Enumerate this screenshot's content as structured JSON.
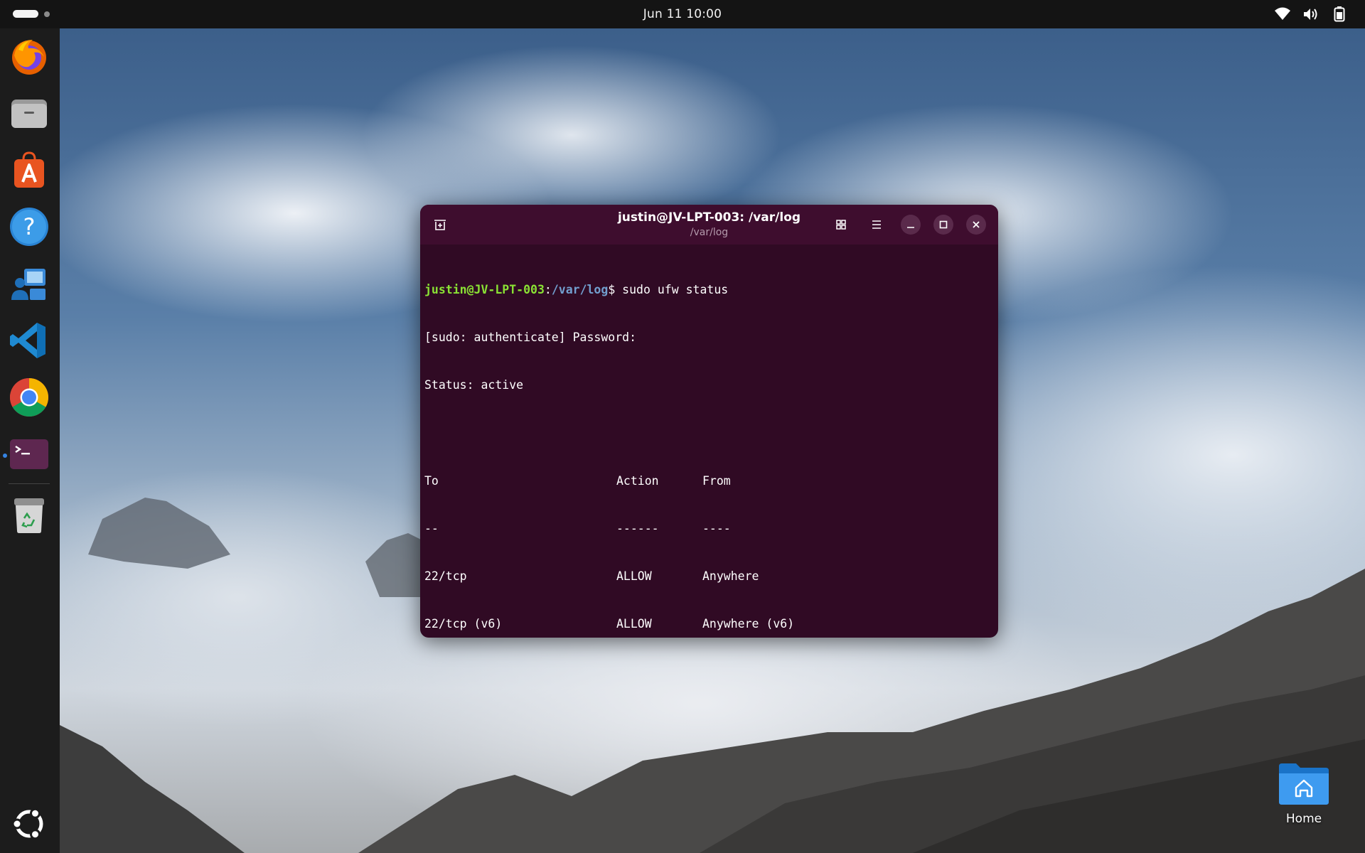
{
  "topbar": {
    "clock": "Jun 11  10:00",
    "tray_icons": [
      "wifi-icon",
      "volume-icon",
      "battery-icon"
    ]
  },
  "dock": {
    "items": [
      {
        "name": "firefox-icon"
      },
      {
        "name": "files-icon"
      },
      {
        "name": "app-center-icon"
      },
      {
        "name": "help-icon"
      },
      {
        "name": "remote-desktop-icon"
      },
      {
        "name": "vscode-icon"
      },
      {
        "name": "chrome-icon"
      },
      {
        "name": "terminal-icon"
      },
      {
        "name": "trash-icon"
      }
    ],
    "show_apps_icon": "ubuntu-show-apps-icon"
  },
  "desktop": {
    "home_label": "Home"
  },
  "terminal": {
    "title": "justin@JV-LPT-003: /var/log",
    "subtitle": "/var/log",
    "prompt_user": "justin@JV-LPT-003",
    "prompt_sep": ":",
    "prompt_path": "/var/log",
    "prompt_dollar": "$",
    "command": " sudo ufw status",
    "sudo_line": "[sudo: authenticate] Password:",
    "status_line": "Status: active",
    "table": {
      "headers": [
        "To",
        "Action",
        "From"
      ],
      "dividers": [
        "--",
        "------",
        "----"
      ],
      "rows": [
        [
          "22/tcp",
          "ALLOW",
          "Anywhere"
        ],
        [
          "22/tcp (v6)",
          "ALLOW",
          "Anywhere (v6)"
        ]
      ]
    }
  },
  "colors": {
    "terminal_bg": "#300a24",
    "header_bg": "#3e0d2e",
    "prompt_user": "#8ae234",
    "prompt_path": "#729fcf",
    "accent": "#3584e4"
  }
}
